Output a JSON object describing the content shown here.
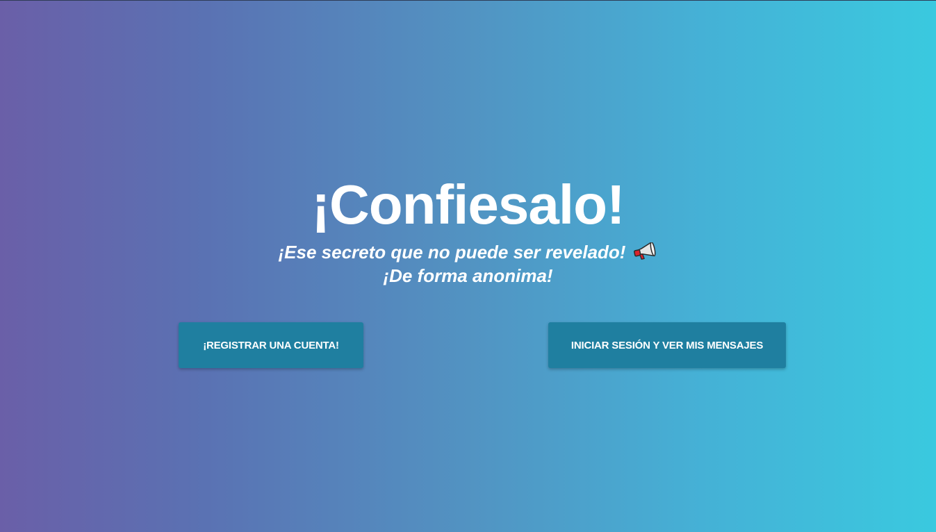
{
  "hero": {
    "title": "¡Confiesalo!",
    "subtitle_line1": "¡Ese secreto que no puede ser revelado!",
    "subtitle_icon": "megaphone-icon",
    "subtitle_line2": "¡De forma anonima!"
  },
  "actions": {
    "register_label": "¡REGISTRAR UNA CUENTA!",
    "login_label": "INICIAR SESIÓN Y VER MIS MENSAJES"
  },
  "colors": {
    "gradient_start": "#6a5fa8",
    "gradient_end": "#3ac9df",
    "button_bg": "#1f7fa0",
    "text": "#ffffff"
  }
}
